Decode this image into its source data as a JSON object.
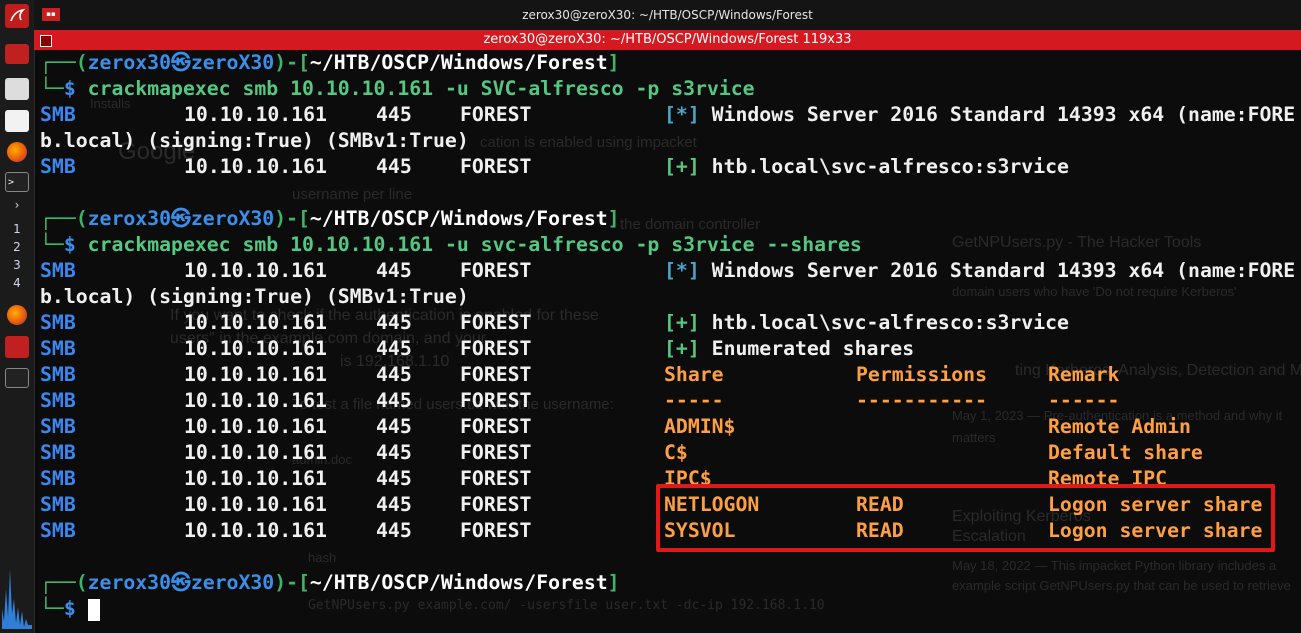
{
  "window": {
    "title": "zerox30@zeroX30: ~/HTB/OSCP/Windows/Forest",
    "terminal_title": "zerox30@zeroX30: ~/HTB/OSCP/Windows/Forest 119x33"
  },
  "dock": {
    "workspaces": [
      "1",
      "2",
      "3",
      "4"
    ],
    "term_glyph": ">"
  },
  "prompt": {
    "corner_top": "┌──(",
    "user": "zerox30",
    "skull": "㉿",
    "host": "zeroX30",
    "sep": ")-[",
    "path": "~/HTB/OSCP/Windows/Forest",
    "close": "]",
    "corner_bottom": "└─",
    "dollar": "$"
  },
  "commands": [
    "crackmapexec smb 10.10.10.161 -u SVC-alfresco -p s3rvice",
    "crackmapexec smb 10.10.10.161 -u svc-alfresco -p s3rvice --shares"
  ],
  "output": {
    "proto": "SMB",
    "ip": "10.10.10.161",
    "port": "445",
    "host": "FOREST",
    "info_tag": "[*]",
    "ok_tag": "[+]",
    "info_text": "Windows Server 2016 Standard 14393 x64 (name:FORE",
    "info_wrap": "b.local) (signing:True) (SMBv1:True)",
    "auth_text": "htb.local\\svc-alfresco:s3rvice",
    "enum_text": "Enumerated shares",
    "share_header": [
      "Share",
      "Permissions",
      "Remark"
    ],
    "share_rule": [
      "-----",
      "-----------",
      "------"
    ],
    "shares": [
      {
        "name": "ADMIN$",
        "perm": "",
        "remark": "Remote Admin"
      },
      {
        "name": "C$",
        "perm": "",
        "remark": "Default share"
      },
      {
        "name": "IPC$",
        "perm": "",
        "remark": "Remote IPC"
      },
      {
        "name": "NETLOGON",
        "perm": "READ",
        "remark": "Logon server share"
      },
      {
        "name": "SYSVOL",
        "perm": "READ",
        "remark": "Logon server share"
      }
    ]
  },
  "ghost_text": [
    "Installs",
    "Google",
    "cation is enabled using impacket",
    "username per line",
    "the domain controller",
    "GetNPUsers.py - The Hacker Tools",
    "domain users who have 'Do not require Kerberos'",
    "If you want to check if the authentication is enabled for these",
    "users\" in the example.com domain, and your",
    "is 192.168.1.10",
    "To test a file named users.txt with the username:",
    "ting Kerberos: Analysis, Detection and Mitigat",
    "May 1, 2023 — Pre-authentication is a method and why it",
    "matters",
    "Exploiting Kerberos",
    "Escalation",
    "May 18, 2022 — This impacket Python library includes a",
    "example script GetNPUsers.py that can be used to retrieve",
    "hash",
    "GetNPUsers.py example.com/ -usersfile user.txt -dc-ip 192.168.1.10",
    "admin.doc"
  ],
  "colors": {
    "kali_red": "#d41a20",
    "prompt_blue": "#3b8eea",
    "prompt_green": "#3fb36b",
    "smb_blue": "#3d86f0",
    "share_orange": "#ff9f43",
    "highlight_box": "#e01818"
  }
}
